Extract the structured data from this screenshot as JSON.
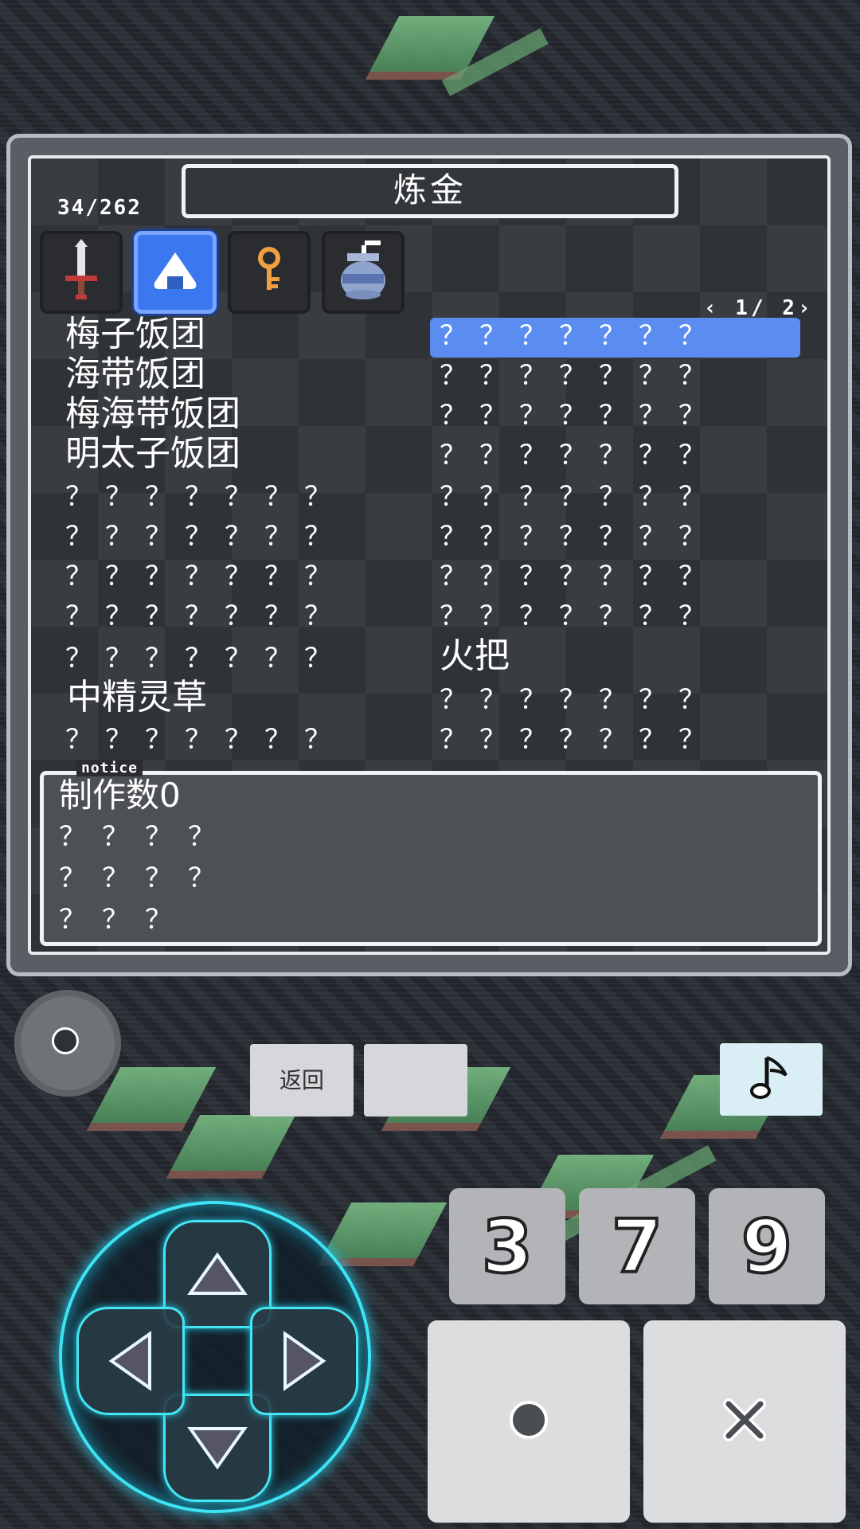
{
  "header": {
    "title": "炼金",
    "count": "34/262",
    "pager": "‹ 1/ 2›"
  },
  "tabs": [
    {
      "name": "weapons",
      "icon": "sword-icon",
      "active": false
    },
    {
      "name": "food",
      "icon": "onigiri-icon",
      "active": true
    },
    {
      "name": "keys",
      "icon": "key-icon",
      "active": false
    },
    {
      "name": "pots",
      "icon": "jar-icon",
      "active": false
    }
  ],
  "left_list": [
    "梅子饭团",
    "海带饭团",
    "梅海带饭团",
    "明太子饭团",
    "？？？？？？？",
    "？？？？？？？",
    "？？？？？？？",
    "？？？？？？？",
    "？？？？？？？",
    "中精灵草",
    "？？？？？？？"
  ],
  "right_list": [
    "？？？？？？？",
    "？？？？？？？",
    "？？？？？？？",
    "？？？？？？？",
    "？？？？？？？",
    "？？？？？？？",
    "？？？？？？？",
    "？？？？？？？",
    "火把",
    "？？？？？？？",
    "？？？？？？？"
  ],
  "selected_right_index": 0,
  "notice": {
    "tag": "notice",
    "lines": [
      "制作数0",
      "？？？？",
      "？？？？",
      "？？？"
    ]
  },
  "controls": {
    "back_label": "返回",
    "blank_label": "",
    "num_buttons": [
      "3",
      "7",
      "9"
    ],
    "circle_label": "●",
    "cross_label": "×"
  },
  "colors": {
    "selection": "#5b8cf0",
    "active_tab": "#3b78f0",
    "dpad_glow": "#3ee3f2"
  }
}
